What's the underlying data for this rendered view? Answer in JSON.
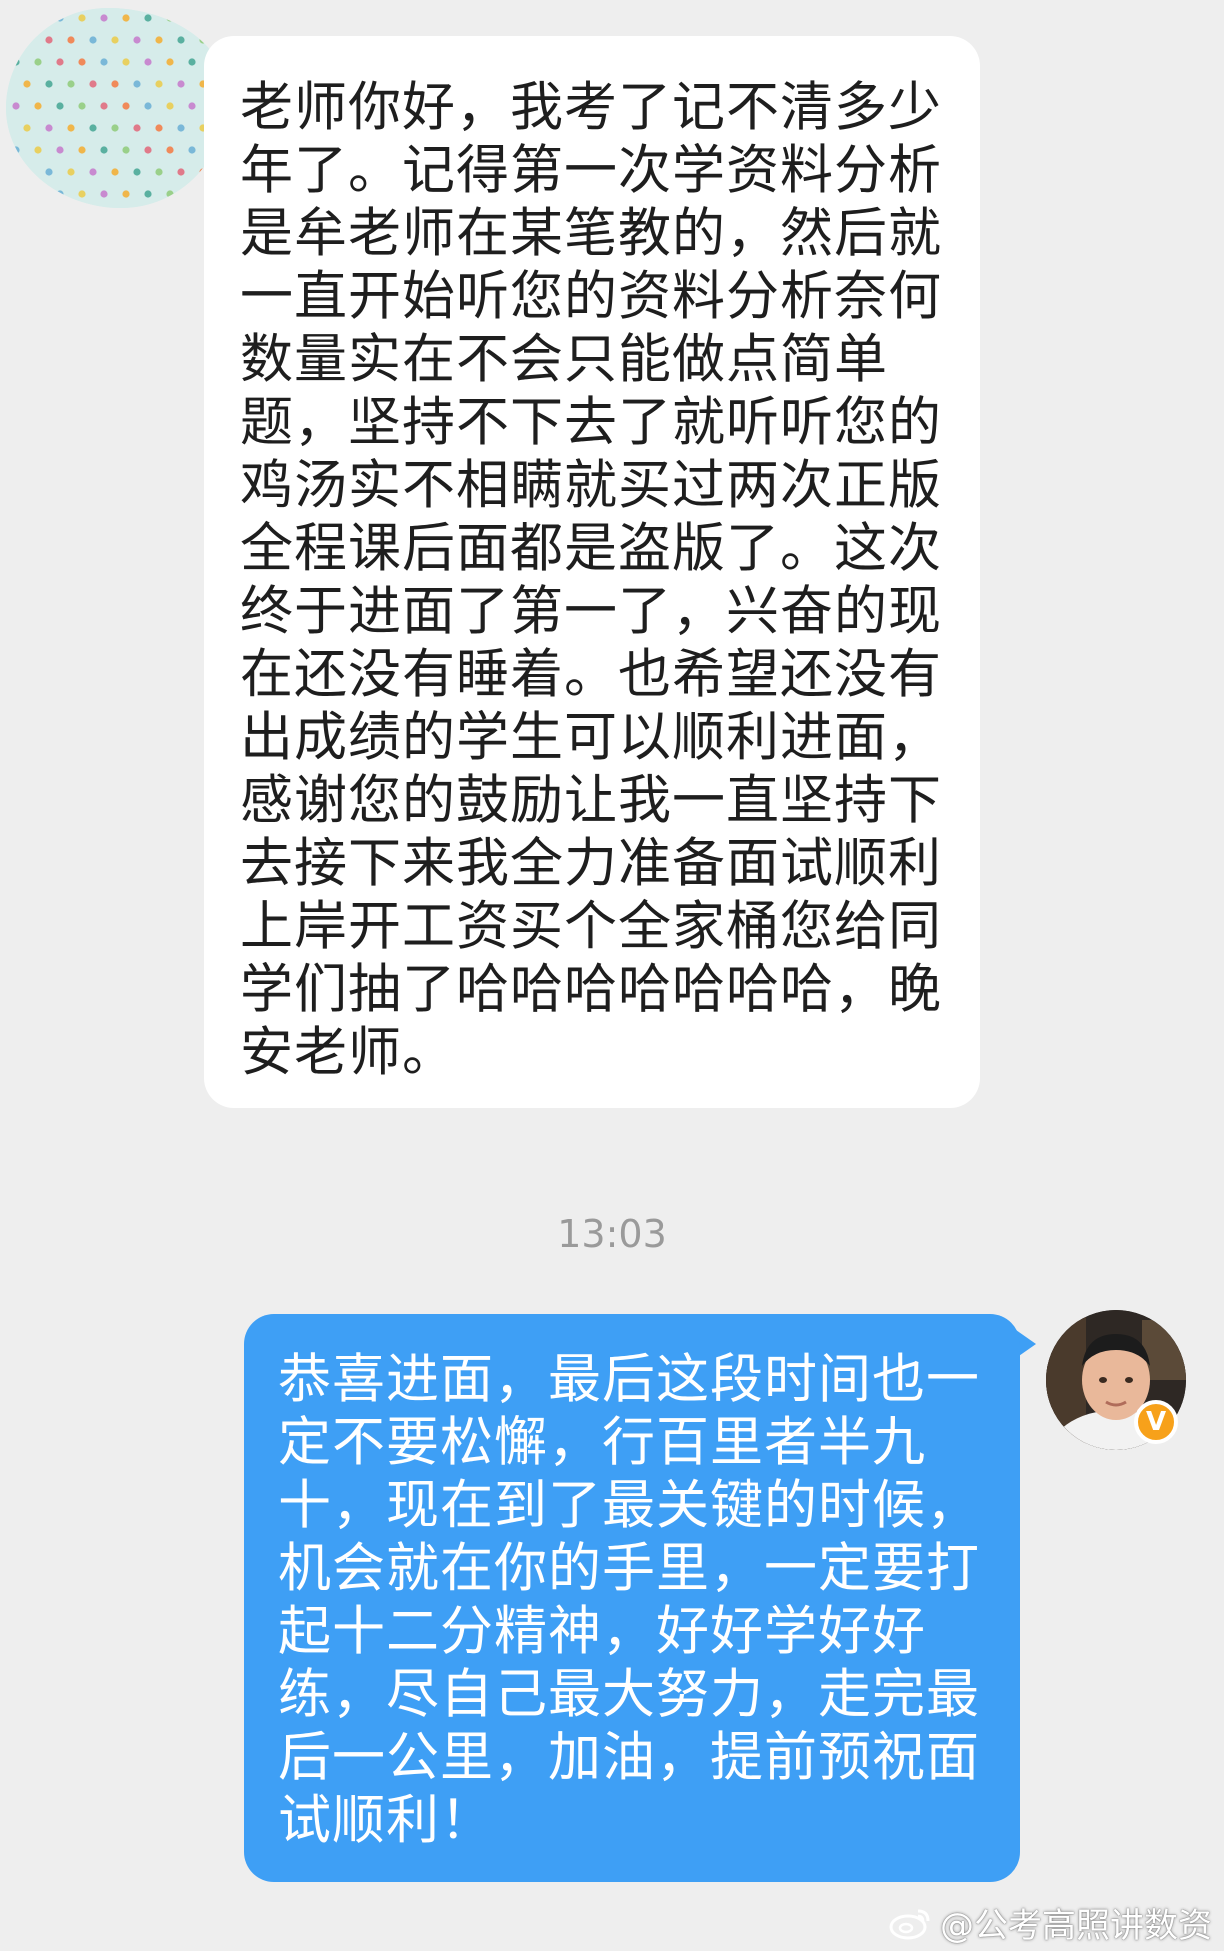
{
  "colors": {
    "background": "#eeeeee",
    "incoming_bubble": "#ffffff",
    "outgoing_bubble": "#3e9ff5",
    "timestamp_text": "#9a9a9a",
    "vip_badge": "#f7a11a"
  },
  "messages": {
    "incoming": {
      "text": "老师你好，我考了记不清多少年了。记得第一次学资料分析是牟老师在某笔教的，然后就一直开始听您的资料分析奈何数量实在不会只能做点简单题，坚持不下去了就听听您的鸡汤实不相瞒就买过两次正版全程课后面都是盗版了。这次终于进面了第一了，兴奋的现在还没有睡着。也希望还没有出成绩的学生可以顺利进面，感谢您的鼓励让我一直坚持下去接下来我全力准备面试顺利上岸开工资买个全家桶您给同学们抽了哈哈哈哈哈哈哈，晚安老师。"
    },
    "timestamp": "13:03",
    "outgoing": {
      "text": "恭喜进面，最后这段时间也一定不要松懈，行百里者半九十，现在到了最关键的时候，机会就在你的手里，一定要打起十二分精神，好好学好好练，尽自己最大努力，走完最后一公里，加油，提前预祝面试顺利！"
    }
  },
  "avatars": {
    "sender_icon": "polka-dot-avatar",
    "receiver_icon": "person-photo-avatar",
    "badge_label": "V"
  },
  "watermark": {
    "icon": "weibo-icon",
    "text": "@公考高照讲数资"
  }
}
